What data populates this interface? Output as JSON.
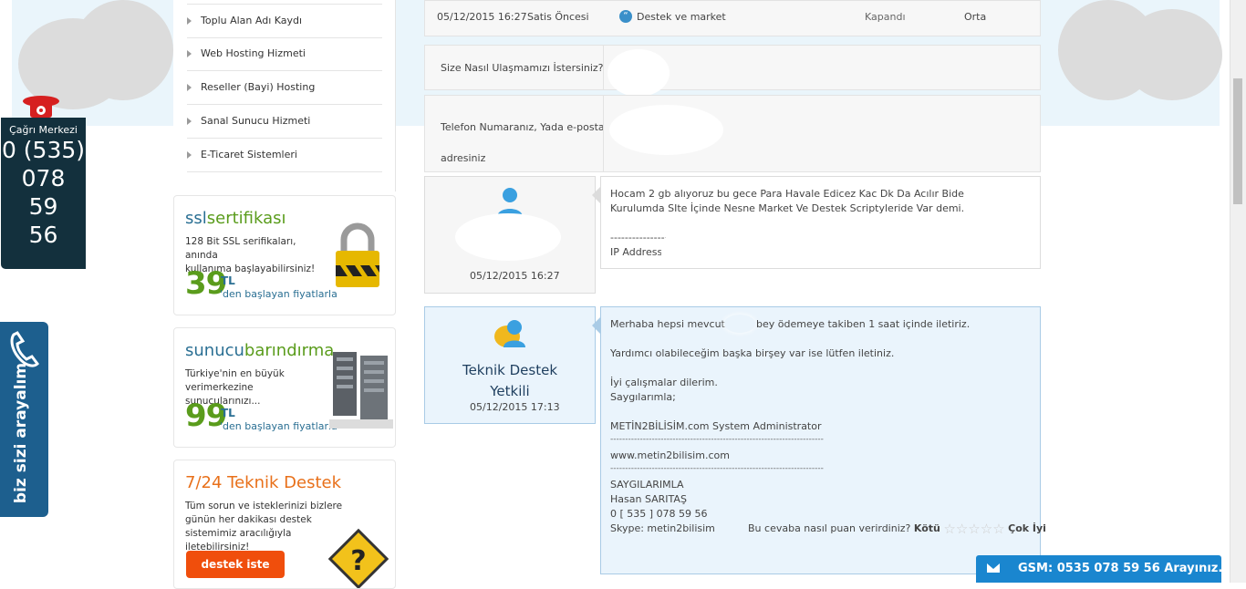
{
  "sidebar": {
    "menu": [
      {
        "label": "Toplu Alan Adı Kaydı"
      },
      {
        "label": "Web Hosting Hizmeti"
      },
      {
        "label": "Reseller (Bayi) Hosting"
      },
      {
        "label": "Sanal Sunucu Hizmeti"
      },
      {
        "label": "E-Ticaret Sistemleri"
      }
    ],
    "ssl": {
      "title_a": "ssl",
      "title_b": "sertifikası",
      "desc_1": "128 Bit SSL serifikaları, anında",
      "desc_2": "kullanıma başlayabilirsiniz!",
      "price": "39",
      "currency": "TL",
      "price_note": "'den başlayan fiyatlarla"
    },
    "server": {
      "title_a": "sunucu",
      "title_b": "barındırma",
      "desc_1": "Türkiye'nin en büyük",
      "desc_2": "verimerkezine sunucularınızı...",
      "price": "99",
      "currency": "TL",
      "price_note": "'den başlayan fiyatlarla"
    },
    "support": {
      "title": "7/24 Teknik Destek",
      "desc_1": "Tüm sorun ve isteklerinizi bizlere",
      "desc_2": "günün her dakikası destek",
      "desc_3": "sistemimiz aracılığıyla iletebilirsiniz!",
      "button": "destek iste"
    }
  },
  "call_center": {
    "label": "Çağrı Merkezi",
    "number_lines": [
      "0 (535)",
      "078",
      "59",
      "56"
    ]
  },
  "callback": {
    "label": "biz sizi arayalım"
  },
  "ticket": {
    "date": "05/12/2015 16:27",
    "department": "Satis Öncesi",
    "subject": "Destek ve market",
    "status": "Kapandı",
    "priority": "Orta",
    "field_1_label": "Size Nasıl Ulaşmamızı İstersiniz?",
    "field_2_label_1": "Telefon Numaranız, Yada e-posta",
    "field_2_label_2": "adresiniz"
  },
  "messages": [
    {
      "author_date": "05/12/2015 16:27",
      "lines": [
        "Hocam 2 gb alıyoruz bu gece Para Havale Edicez Kac Dk Da Acılır Bide",
        "Kurulumda SIte İçinde Nesne Market Ve Destek Scriptyleride Var demi.",
        "----------------",
        "IP Address"
      ]
    },
    {
      "author_line_1": "Teknik Destek",
      "author_line_2": "Yetkili",
      "author_date": "05/12/2015 17:13",
      "line_1a": "Merhaba hepsi mevcuttur",
      "line_1b": "bey ödemeye takiben 1 saat içinde iletiriz.",
      "line_2": "Yardımcı olabileceğim başka birşey var ise lütfen iletiniz.",
      "line_3": "İyi çalışmalar dilerim.",
      "line_4": "Saygılarımla;",
      "line_5": "METİN2BİLİSİM.com System Administrator",
      "separator": "------------------------------------------------------------------------",
      "line_6": "www.metin2bilisim.com",
      "line_7": "SAYGILARIMLA",
      "line_8": "Hasan SARITAŞ",
      "line_9": "0 [ 535 ] 078 59 56",
      "line_10": "Skype: metin2bilisim",
      "rating_question": "Bu cevaba nasıl puan verirdiniz?",
      "rating_low": "Kötü",
      "rating_high": "Çok İyi"
    }
  ],
  "gsm_bar": {
    "label": "GSM: 0535 078 59 56 Arayınız."
  },
  "colors": {
    "accent_blue": "#1a86cf",
    "green_price": "#5a9c1c",
    "orange": "#f04e0c",
    "dark_teal": "#13303d"
  }
}
